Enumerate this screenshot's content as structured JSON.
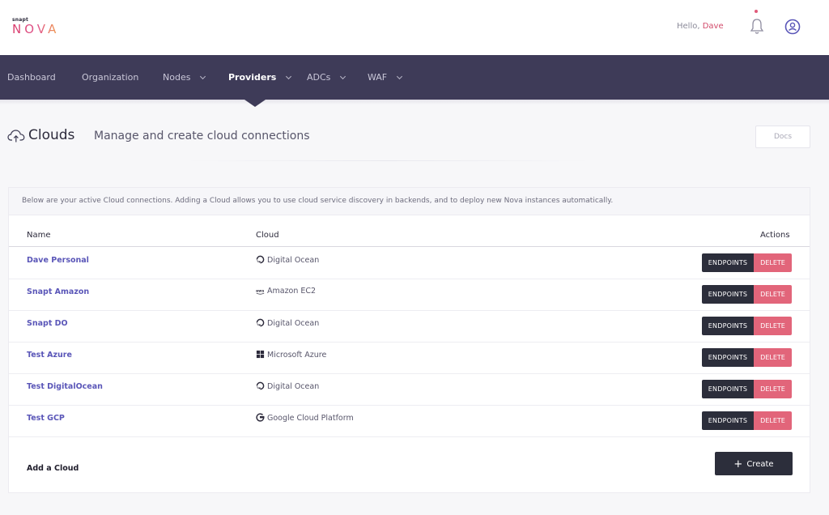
{
  "brand": {
    "small": "snapt",
    "main": "NOVA"
  },
  "header": {
    "greeting": "Hello,",
    "user_name": "Dave"
  },
  "nav": {
    "items": [
      {
        "label": "Dashboard",
        "has_menu": false,
        "active": false
      },
      {
        "label": "Organization",
        "has_menu": false,
        "active": false
      },
      {
        "label": "Nodes",
        "has_menu": true,
        "active": false
      },
      {
        "label": "Providers",
        "has_menu": true,
        "active": true
      },
      {
        "label": "ADCs",
        "has_menu": true,
        "active": false
      },
      {
        "label": "WAF",
        "has_menu": true,
        "active": false
      }
    ]
  },
  "page": {
    "title": "Clouds",
    "subtitle": "Manage and create cloud connections",
    "docs_label": "Docs",
    "icon": "cloud-upload-icon"
  },
  "card": {
    "intro": "Below are your active Cloud connections. Adding a Cloud allows you to use cloud service discovery in backends, and to deploy new Nova instances automatically.",
    "columns": {
      "name": "Name",
      "cloud": "Cloud",
      "actions": "Actions"
    },
    "rows": [
      {
        "name": "Dave Personal",
        "cloud": "Digital Ocean",
        "provider_icon": "digital-ocean-icon"
      },
      {
        "name": "Snapt Amazon",
        "cloud": "Amazon EC2",
        "provider_icon": "aws-icon"
      },
      {
        "name": "Snapt DO",
        "cloud": "Digital Ocean",
        "provider_icon": "digital-ocean-icon"
      },
      {
        "name": "Test Azure",
        "cloud": "Microsoft Azure",
        "provider_icon": "microsoft-icon"
      },
      {
        "name": "Test DigitalOcean",
        "cloud": "Digital Ocean",
        "provider_icon": "digital-ocean-icon"
      },
      {
        "name": "Test GCP",
        "cloud": "Google Cloud Platform",
        "provider_icon": "google-icon"
      }
    ],
    "endpoints_label": "ENDPOINTS",
    "delete_label": "DELETE",
    "add_cloud_label": "Add a Cloud",
    "create_label": "Create"
  },
  "colors": {
    "navbar": "#3e3b58",
    "link": "#5a56b8",
    "danger": "#e2657a",
    "dark_button": "#2c2e3b",
    "brand_pink": "#d93a6a"
  }
}
